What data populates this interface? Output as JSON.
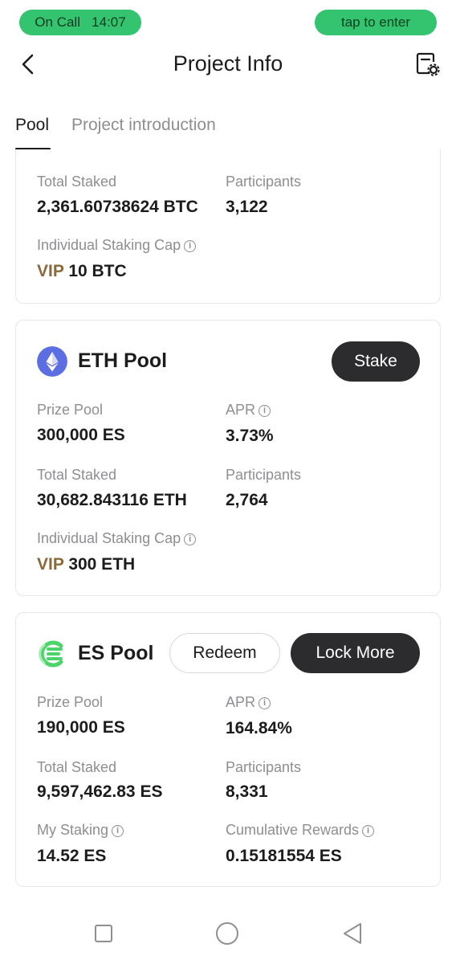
{
  "status": {
    "call_label": "On Call",
    "call_time": "14:07",
    "enter_label": "tap to enter"
  },
  "header": {
    "title": "Project Info"
  },
  "tabs": [
    {
      "label": "Pool",
      "active": true
    },
    {
      "label": "Project introduction",
      "active": false
    }
  ],
  "btc_pool": {
    "total_staked_label": "Total Staked",
    "total_staked": "2,361.60738624 BTC",
    "participants_label": "Participants",
    "participants": "3,122",
    "cap_label": "Individual Staking Cap",
    "cap_vip": "VIP",
    "cap_value": "10 BTC"
  },
  "eth_pool": {
    "name": "ETH Pool",
    "stake_label": "Stake",
    "prize_label": "Prize Pool",
    "prize": "300,000 ES",
    "apr_label": "APR",
    "apr": "3.73%",
    "total_staked_label": "Total Staked",
    "total_staked": "30,682.843116 ETH",
    "participants_label": "Participants",
    "participants": "2,764",
    "cap_label": "Individual Staking Cap",
    "cap_vip": "VIP",
    "cap_value": "300 ETH"
  },
  "es_pool": {
    "name": "ES Pool",
    "redeem_label": "Redeem",
    "lock_label": "Lock More",
    "prize_label": "Prize Pool",
    "prize": "190,000 ES",
    "apr_label": "APR",
    "apr": "164.84%",
    "total_staked_label": "Total Staked",
    "total_staked": "9,597,462.83 ES",
    "participants_label": "Participants",
    "participants": "8,331",
    "my_staking_label": "My Staking",
    "my_staking": "14.52 ES",
    "rewards_label": "Cumulative Rewards",
    "rewards": "0.15181554 ES"
  },
  "icons": {
    "back": "chevron-left-icon",
    "settings": "document-settings-icon",
    "info": "info-circle-icon",
    "eth": "ethereum-logo-icon",
    "es": "es-logo-icon",
    "nav_recent": "square-icon",
    "nav_home": "circle-icon",
    "nav_back": "triangle-back-icon"
  },
  "colors": {
    "call_green": "#34c36e",
    "vip_gold": "#8a6a3a",
    "eth_blue": "#5b6fe3",
    "es_green": "#4cd36a",
    "dark_button": "#2c2c2e"
  }
}
